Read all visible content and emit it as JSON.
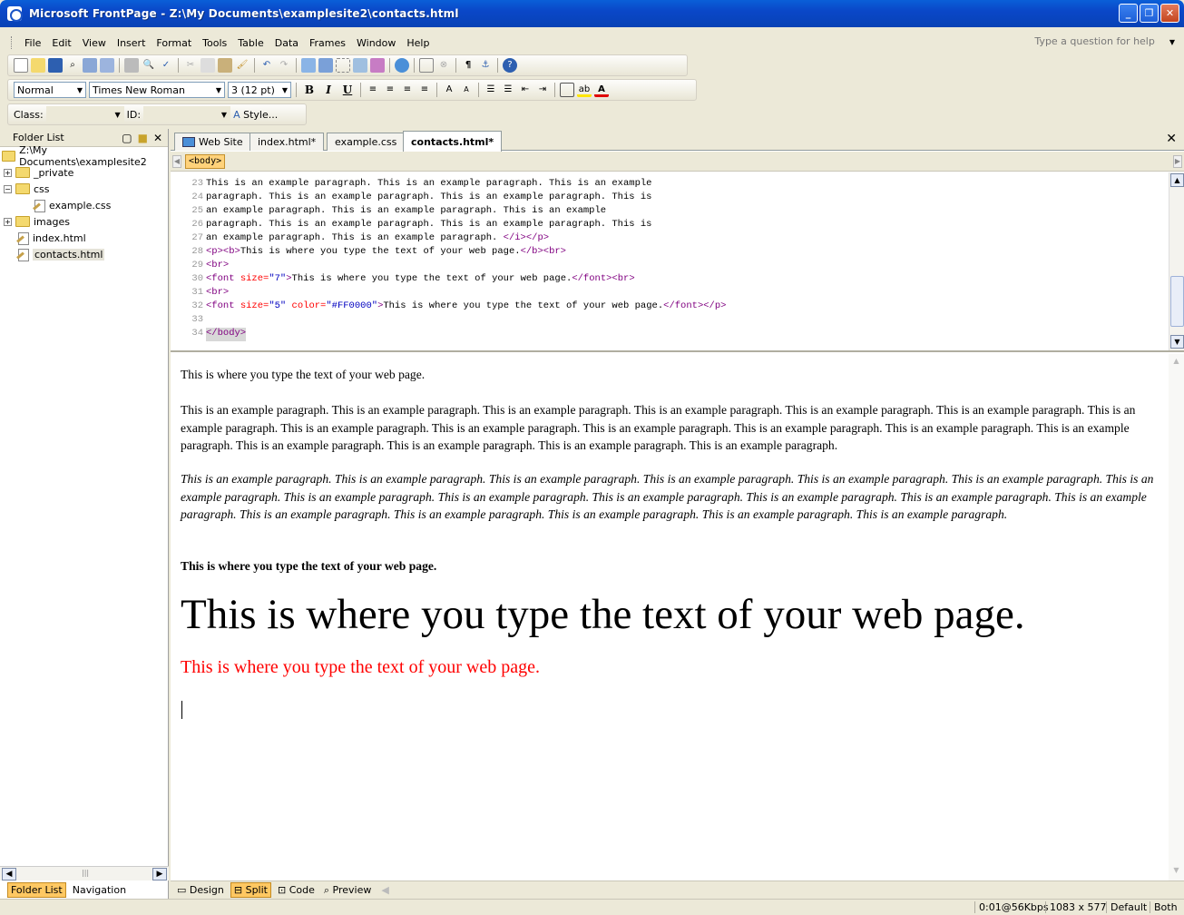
{
  "window": {
    "title": "Microsoft FrontPage - Z:\\My Documents\\examplesite2\\contacts.html",
    "minimize": "_",
    "restore": "❐",
    "close": "✕"
  },
  "menu": [
    "File",
    "Edit",
    "View",
    "Insert",
    "Format",
    "Tools",
    "Table",
    "Data",
    "Frames",
    "Window",
    "Help"
  ],
  "help_placeholder": "Type a question for help",
  "formatting": {
    "style": "Normal",
    "font": "Times New Roman",
    "size": "3 (12 pt)"
  },
  "style_toolbar": {
    "class_label": "Class:",
    "id_label": "ID:",
    "style_button": "Style..."
  },
  "folder_list": {
    "title": "Folder List",
    "root": "Z:\\My Documents\\examplesite2",
    "items": [
      {
        "label": "_private",
        "expander": "+"
      },
      {
        "label": "css",
        "expander": "−"
      },
      {
        "label": "example.css"
      },
      {
        "label": "images",
        "expander": "+"
      },
      {
        "label": "index.html"
      },
      {
        "label": "contacts.html"
      }
    ],
    "bottom_tabs": [
      "Folder List",
      "Navigation"
    ]
  },
  "tabs": [
    "Web Site",
    "index.html*",
    "example.css",
    "contacts.html*"
  ],
  "tag_selector": "<body>",
  "code_lines": [
    {
      "n": "23",
      "text": "This is an example paragraph. This is an example paragraph. This is an example"
    },
    {
      "n": "24",
      "text": "paragraph. This is an example paragraph. This is an example paragraph. This is"
    },
    {
      "n": "25",
      "text": "an example paragraph. This is an example paragraph. This is an example"
    },
    {
      "n": "26",
      "text": "paragraph. This is an example paragraph. This is an example paragraph. This is"
    },
    {
      "n": "27",
      "text": "an example paragraph. This is an example paragraph. ",
      "tail": "</i></p>"
    },
    {
      "n": "28",
      "pre": "<p><b>",
      "text": "This is where you type the text of your web page.",
      "tail": "</b><br>"
    },
    {
      "n": "29",
      "pre": "<br>"
    },
    {
      "n": "30",
      "tag_open": "<font ",
      "attr": "size=",
      "val": "\"7\"",
      "close": ">",
      "text": "This is where you type the text of your web page.",
      "tail": "</font><br>"
    },
    {
      "n": "31",
      "pre": "<br>"
    },
    {
      "n": "32",
      "tag_open": "<font ",
      "attr": "size=",
      "val": "\"5\"",
      "attr2": " color=",
      "val2": "\"#FF0000\"",
      "close": ">",
      "text": "This is where you type the text of your web page.",
      "tail": "</font></p>"
    },
    {
      "n": "33"
    },
    {
      "n": "34",
      "pre": "</body>"
    }
  ],
  "design": {
    "p1": "This is where you type the text of your web page.",
    "p2": "This is an example paragraph. This is an example paragraph. This is an example paragraph. This is an example paragraph. This is an example paragraph. This is an example paragraph. This is an example paragraph. This is an example paragraph. This is an example paragraph. This is an example paragraph. This is an example paragraph. This is an example paragraph. This is an example paragraph. This is an example paragraph. This is an example paragraph. This is an example paragraph. This is an example paragraph.",
    "p3": "This is an example paragraph. This is an example paragraph. This is an example paragraph. This is an example paragraph. This is an example paragraph. This is an example paragraph. This is an example paragraph. This is an example paragraph. This is an example paragraph. This is an example paragraph. This is an example paragraph. This is an example paragraph. This is an example paragraph. This is an example paragraph. This is an example paragraph. This is an example paragraph. This is an example paragraph. This is an example paragraph.",
    "p4": "This is where you type the text of your web page.",
    "p5": "This is where you type the text of your web page.",
    "p6": "This is where you type the text of your web page.",
    "red_color": "#ff0000"
  },
  "view_modes": [
    "Design",
    "Split",
    "Code",
    "Preview"
  ],
  "status": {
    "speed": "0:01@56Kbps",
    "dims": "1083 x 577",
    "mode": "Default",
    "both": "Both"
  }
}
